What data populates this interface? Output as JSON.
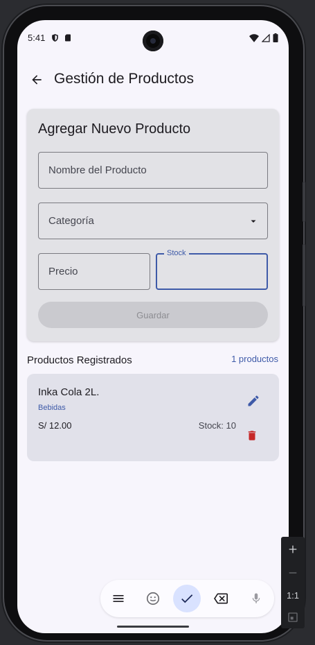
{
  "status_bar": {
    "time": "5:41"
  },
  "app_bar": {
    "title": "Gestión de Productos"
  },
  "form": {
    "title": "Agregar Nuevo Producto",
    "name_placeholder": "Nombre del Producto",
    "category_placeholder": "Categoría",
    "price_placeholder": "Precio",
    "stock_label": "Stock",
    "save_label": "Guardar"
  },
  "list": {
    "title": "Productos Registrados",
    "count": "1 productos",
    "items": [
      {
        "name": "Inka Cola 2L.",
        "category": "Bebidas",
        "price": "S/ 12.00",
        "stock": "Stock: 10"
      }
    ]
  },
  "emulator": {
    "zoom_label": "1:1"
  },
  "colors": {
    "accent": "#3e5aa8",
    "delete": "#c62828",
    "background": "#f7f5fc",
    "card": "#e2e2e6"
  }
}
